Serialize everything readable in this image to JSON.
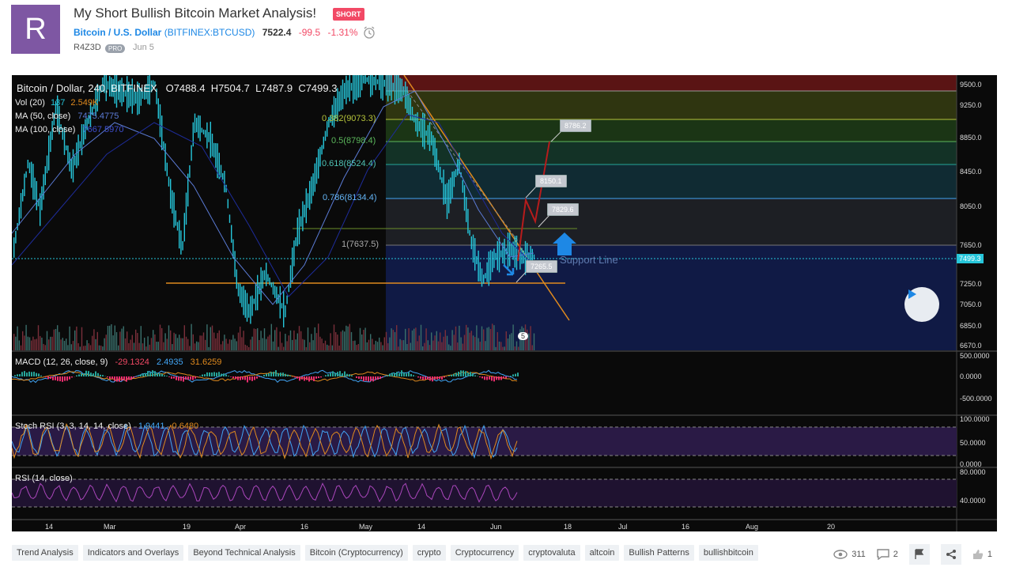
{
  "header": {
    "avatar_letter": "R",
    "title": "My Short Bullish Bitcoin Market Analysis!",
    "badge": "SHORT",
    "symbol_name": "Bitcoin / U.S. Dollar",
    "exchange": "(BITFINEX:BTCUSD)",
    "price": "7522.4",
    "change": "-99.5",
    "change_pct": "-1.31%",
    "author": "R4Z3D",
    "pro_badge": "PRO",
    "date": "Jun 5"
  },
  "chart": {
    "legend_main": "Bitcoin / Dollar, 240, BITFINEX",
    "ohlc_o": "O7488.4",
    "ohlc_h": "H7504.7",
    "ohlc_l": "L7487.9",
    "ohlc_c": "C7499.3",
    "vol_label": "Vol (20)",
    "vol_val1": "137",
    "vol_val2": "2.549K",
    "ma50_label": "MA (50, close)",
    "ma50_val": "7475.4775",
    "ma100_label": "MA (100, close)",
    "ma100_val": "7667.5970",
    "macd_label": "MACD (12, 26, close, 9)",
    "macd_v1": "-29.1324",
    "macd_v2": "2.4935",
    "macd_v3": "31.6259",
    "stoch_label": "Stoch RSI (3, 3, 14, 14, close)",
    "stoch_v1": "1.9441",
    "stoch_v2": "0.6480",
    "rsi_label": "RSI (14, close)",
    "price_axis": [
      "9500.0",
      "9250.0",
      "8850.0",
      "8450.0",
      "8050.0",
      "7650.0",
      "7250.0",
      "7050.0",
      "6850.0",
      "6670.0"
    ],
    "current_price_tag": "7499.3",
    "macd_axis": [
      "500.0000",
      "0.0000",
      "-500.0000"
    ],
    "stoch_axis": [
      "100.0000",
      "50.0000",
      "0.0000"
    ],
    "rsi_axis": [
      "80.0000",
      "40.0000"
    ],
    "time_axis": [
      "14",
      "Mar",
      "19",
      "Apr",
      "16",
      "May",
      "14",
      "Jun",
      "18",
      "Jul",
      "16",
      "Aug",
      "20"
    ],
    "fib_levels": [
      "0.382(9073.3)",
      "0.5(8798.4)",
      "0.618(8524.4)",
      "0.786(8134.4)",
      "1(7637.5)"
    ],
    "callouts": [
      "8786.2",
      "8150.1",
      "7829.6",
      "7265.5"
    ],
    "support_text": "Support Line",
    "marker_count": "5"
  },
  "tags": [
    "Trend Analysis",
    "Indicators and Overlays",
    "Beyond Technical Analysis",
    "Bitcoin (Cryptocurrency)",
    "crypto",
    "Cryptocurrency",
    "cryptovaluta",
    "altcoin",
    "Bullish Patterns",
    "bullishbitcoin"
  ],
  "stats": {
    "views": "311",
    "comments": "2",
    "likes": "1"
  },
  "colors": {
    "accent": "#1e88e5",
    "negative": "#f24965",
    "candle": "#26c6da",
    "fib_gold": "#e08a1e"
  },
  "icons": [
    "alarm-clock-icon",
    "play-icon",
    "eye-icon",
    "comment-icon",
    "flag-icon",
    "share-icon",
    "thumbs-up-icon"
  ]
}
